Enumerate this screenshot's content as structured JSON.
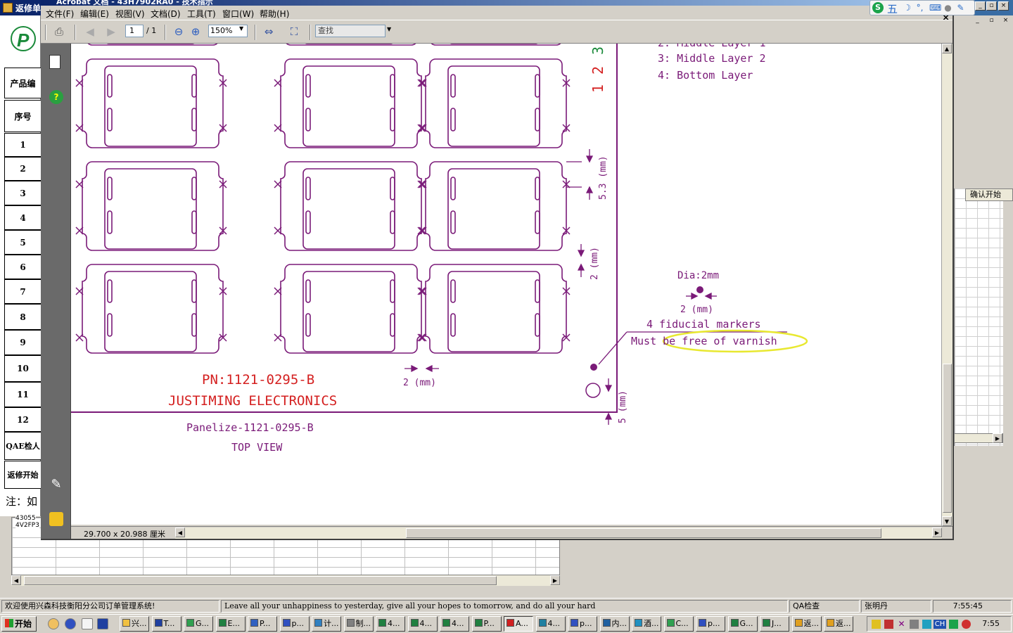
{
  "background_app": {
    "title": "返修单",
    "header_cells": [
      "产品编",
      "序号"
    ],
    "row_numbers": [
      "1",
      "2",
      "3",
      "4",
      "5",
      "6",
      "7",
      "8",
      "9",
      "10",
      "11",
      "12"
    ],
    "footer_cells": [
      "QAE检人",
      "返修开始"
    ],
    "note": "注：如",
    "sheet_texts": [
      "43055",
      "4V2FP3"
    ],
    "right_column_header": "确认开始"
  },
  "status_bar": {
    "welcome": "欢迎使用兴森科技衡阳分公司订单管理系统!",
    "motto": "Leave all your unhappiness to yesterday, give all your hopes to tomorrow, and do all your hard",
    "module": "QA检查",
    "user": "张明丹",
    "time": "7:55:45"
  },
  "taskbar": {
    "start_label": "开始",
    "tasks": [
      "兴...",
      "T...",
      "G...",
      "E...",
      "P...",
      "p...",
      "计...",
      "制...",
      "4...",
      "4...",
      "4...",
      "P...",
      "A...",
      "4...",
      "p...",
      "内...",
      "酒...",
      "C...",
      "p...",
      "G...",
      "J...",
      "返...",
      "返..."
    ],
    "active_task_index": 12,
    "clock": "7:55",
    "tray_lang": "CH"
  },
  "acrobat": {
    "title": "Acrobat 文档 - 43H7902RA0 - 技术指示",
    "menu": [
      "文件(F)",
      "编辑(E)",
      "视图(V)",
      "文档(D)",
      "工具(T)",
      "窗口(W)",
      "帮助(H)"
    ],
    "ime_mode": "五",
    "page_current": "1",
    "page_total": "/ 1",
    "zoom": "150%",
    "search_placeholder": "查找",
    "page_size": "29.700 x 20.988 厘米"
  },
  "drawing": {
    "layers": [
      "2:  Middle Layer 1",
      "3:  Middle Layer 2",
      "4:  Bottom Layer"
    ],
    "layer_numbers": [
      "1",
      "2",
      "3"
    ],
    "dim_53": "5.3 (mm)",
    "dim_2_vertical": "2 (mm)",
    "dim_2_horizontal": "2 (mm)",
    "dim_5": "5 (mm)",
    "dia": "Dia:2mm",
    "dim_2_fiducial": "2 (mm)",
    "fiducial_label": "4 fiducial markers",
    "varnish_label": "Must be free of varnish",
    "pn": "PN:1121-0295-B",
    "company": "JUSTIMING  ELECTRONICS",
    "panelize": "Panelize-1121-0295-B",
    "view": "TOP VIEW",
    "colors": {
      "cad": "#7a1a78",
      "red": "#d42020",
      "highlight": "#e8e830"
    }
  }
}
